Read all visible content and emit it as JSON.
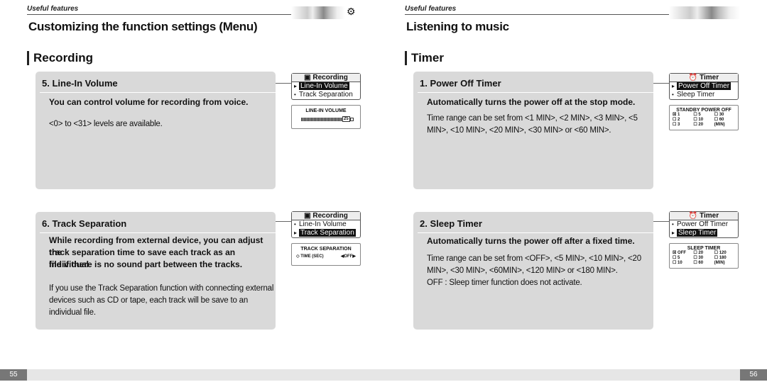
{
  "left": {
    "header": "Useful features",
    "page_title": "Customizing the function settings (Menu)",
    "section": "Recording",
    "page_number": "55",
    "panels": [
      {
        "title": "5. Line-In Volume",
        "bold": "You can control volume for recording from voice.",
        "text": [
          "<0> to <31> levels are available."
        ],
        "lcd": {
          "title": "Recording",
          "items": [
            "Line-In Volume",
            "Track Separation"
          ],
          "selected": 0
        },
        "screen": {
          "title": "LINE-IN VOLUME",
          "value": "25",
          "level": 0.8
        }
      },
      {
        "title": "6. Track Separation",
        "bold": [
          "While recording from external device, you can adjust the",
          "track separation time to save each track as an individual",
          "file if there is no sound part between the tracks."
        ],
        "text": [
          "If you use the Track Separation function with connecting external",
          "devices such as CD or tape, each track will be save to an",
          "individual file."
        ],
        "lcd": {
          "title": "Recording",
          "items": [
            "Line-In Volume",
            "Track Separation"
          ],
          "selected": 1
        },
        "screen": {
          "title": "TRACK SEPARATION",
          "label": "◇ TIME (SEC)",
          "value": "◀OFF▶"
        }
      }
    ]
  },
  "right": {
    "header": "Useful features",
    "page_title": "Listening to music",
    "section": "Timer",
    "page_number": "56",
    "panels": [
      {
        "title": "1. Power Off Timer",
        "bold": "Automatically turns the power off at the stop mode.",
        "text": [
          "Time range can be set from <1 MIN>, <2 MIN>, <3 MIN>, <5",
          "MIN>, <10 MIN>, <20 MIN>, <30 MIN>  or  <60 MIN>."
        ],
        "lcd": {
          "title": "Timer",
          "items": [
            "Power Off Timer",
            "Sleep Timer"
          ],
          "selected": 0
        },
        "screen": {
          "title": "STANDBY POWER OFF",
          "options": [
            "☒ 1",
            "☐ 5",
            "☐ 30",
            "☐ 2",
            "☐ 10",
            "☐ 60",
            "☐ 3",
            "☐ 20",
            "(MIN)"
          ]
        }
      },
      {
        "title": "2. Sleep Timer",
        "bold": "Automatically turns the power off after a fixed time.",
        "text": [
          "Time range can be set from <OFF>, <5 MIN>, <10 MIN>, <20",
          "MIN>, <30 MIN>, <60MIN>, <120 MIN> or <180 MIN>.",
          "OFF : Sleep timer function does not activate."
        ],
        "lcd": {
          "title": "Timer",
          "items": [
            "Power Off Timer",
            "Sleep Timer"
          ],
          "selected": 1
        },
        "screen": {
          "title": "SLEEP TIMER",
          "options": [
            "☒ OFF",
            "☐ 20",
            "☐ 120",
            "☐ 5",
            "☐ 30",
            "☐ 180",
            "☐ 10",
            "☐ 60",
            "(MIN)"
          ]
        }
      }
    ]
  }
}
